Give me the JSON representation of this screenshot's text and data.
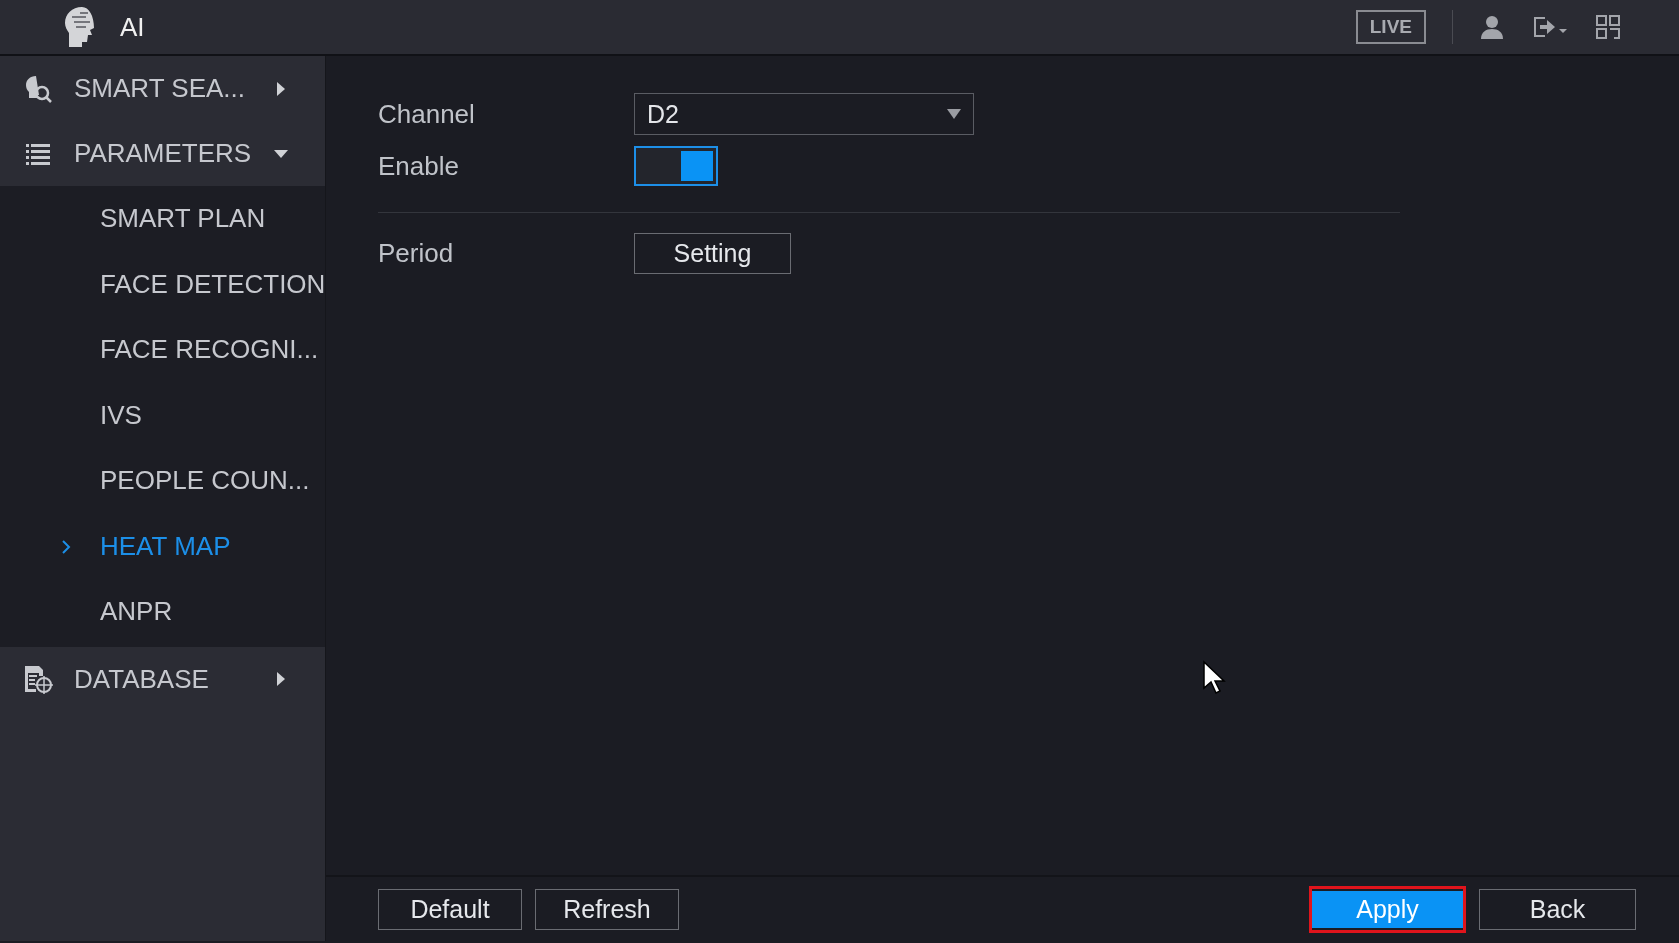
{
  "header": {
    "title": "AI",
    "live": "LIVE"
  },
  "sidebar": {
    "items": [
      {
        "label": "SMART SEA...",
        "expanded": false
      },
      {
        "label": "PARAMETERS",
        "expanded": true,
        "children": [
          {
            "label": "SMART PLAN",
            "selected": false
          },
          {
            "label": "FACE DETECTION",
            "selected": false
          },
          {
            "label": "FACE RECOGNI...",
            "selected": false
          },
          {
            "label": "IVS",
            "selected": false
          },
          {
            "label": "PEOPLE COUN...",
            "selected": false
          },
          {
            "label": "HEAT MAP",
            "selected": true
          },
          {
            "label": "ANPR",
            "selected": false
          }
        ]
      },
      {
        "label": "DATABASE",
        "expanded": false
      }
    ]
  },
  "form": {
    "channel": {
      "label": "Channel",
      "value": "D2"
    },
    "enable": {
      "label": "Enable",
      "on": true
    },
    "period": {
      "label": "Period",
      "button": "Setting"
    }
  },
  "footer": {
    "left_buttons": [
      {
        "label": "Default",
        "kind": "plain",
        "focused": false
      },
      {
        "label": "Refresh",
        "kind": "plain",
        "focused": false
      }
    ],
    "right_buttons": [
      {
        "label": "Apply",
        "kind": "primary",
        "focused": true
      },
      {
        "label": "Back",
        "kind": "plain",
        "focused": false
      }
    ]
  }
}
